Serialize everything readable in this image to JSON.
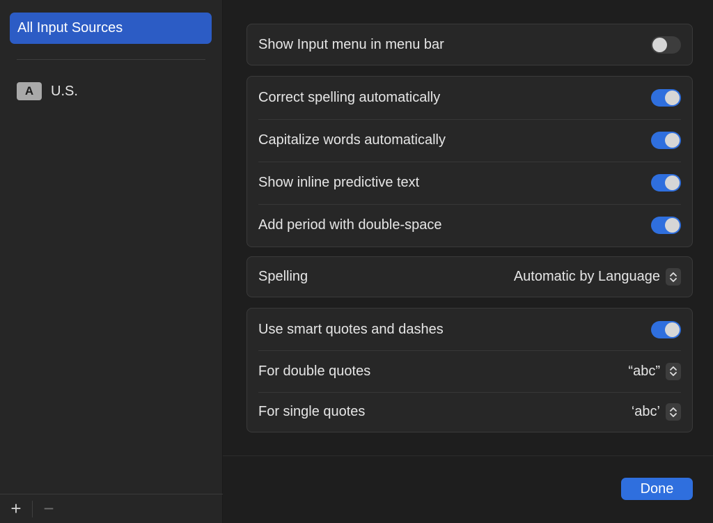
{
  "sidebar": {
    "selected_label": "All Input Sources",
    "items": [
      {
        "badge": "A",
        "label": "U.S."
      }
    ],
    "add_label": "+",
    "remove_label": "−"
  },
  "groups": {
    "menu": {
      "show_input_menu": {
        "label": "Show Input menu in menu bar",
        "on": false
      }
    },
    "typing": {
      "correct_spelling": {
        "label": "Correct spelling automatically",
        "on": true
      },
      "capitalize_words": {
        "label": "Capitalize words automatically",
        "on": true
      },
      "inline_predictive": {
        "label": "Show inline predictive text",
        "on": true
      },
      "period_double_space": {
        "label": "Add period with double-space",
        "on": true
      }
    },
    "spelling": {
      "label": "Spelling",
      "value": "Automatic by Language"
    },
    "quotes": {
      "smart_quotes": {
        "label": "Use smart quotes and dashes",
        "on": true
      },
      "double_quotes": {
        "label": "For double quotes",
        "value": "“abc”"
      },
      "single_quotes": {
        "label": "For single quotes",
        "value": "‘abc’"
      }
    }
  },
  "footer": {
    "done_label": "Done"
  },
  "colors": {
    "accent": "#2f6fde",
    "sidebar_selection": "#2c5cc5",
    "toggle_off": "#3d3d3d"
  },
  "icons": {
    "stepper": "chevron-up-down-icon",
    "add": "plus-icon",
    "remove": "minus-icon"
  }
}
